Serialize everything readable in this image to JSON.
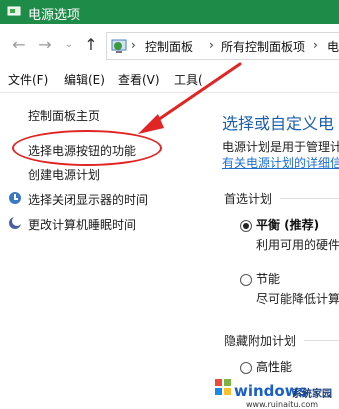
{
  "window": {
    "title": "电源选项",
    "title_bar_color": "#1f8b49"
  },
  "nav": {
    "back_icon": "arrow-left-icon",
    "forward_icon": "arrow-right-icon",
    "recent_icon": "chevron-down-icon",
    "up_icon": "arrow-up-icon",
    "breadcrumb": [
      "控制面板",
      "所有控制面板项",
      "电"
    ]
  },
  "menu": {
    "items": [
      "文件(F)",
      "编辑(E)",
      "查看(V)",
      "工具("
    ]
  },
  "left_pane": {
    "home_link": "控制面板主页",
    "links": [
      "选择电源按钮的功能",
      "创建电源计划",
      "选择关闭显示器的时间",
      "更改计算机睡眠时间"
    ]
  },
  "right_pane": {
    "heading": "选择或自定义电",
    "desc_line1": "电源计划是用于管理计",
    "desc_link": "有关电源计划的详细信",
    "preferred_group": "首选计划",
    "plans": [
      {
        "name": "平衡 (推荐)",
        "desc": "利用可用的硬件",
        "selected": true
      },
      {
        "name": "节能",
        "desc": "尽可能降低计算",
        "selected": false
      }
    ],
    "hidden_group": "隐藏附加计划",
    "hidden_partial": "高性能"
  },
  "annotation": {
    "color": "#e12424"
  },
  "watermark": {
    "brand": "windows",
    "cn": "系统家园",
    "url": "www.ruinaitu.com"
  }
}
